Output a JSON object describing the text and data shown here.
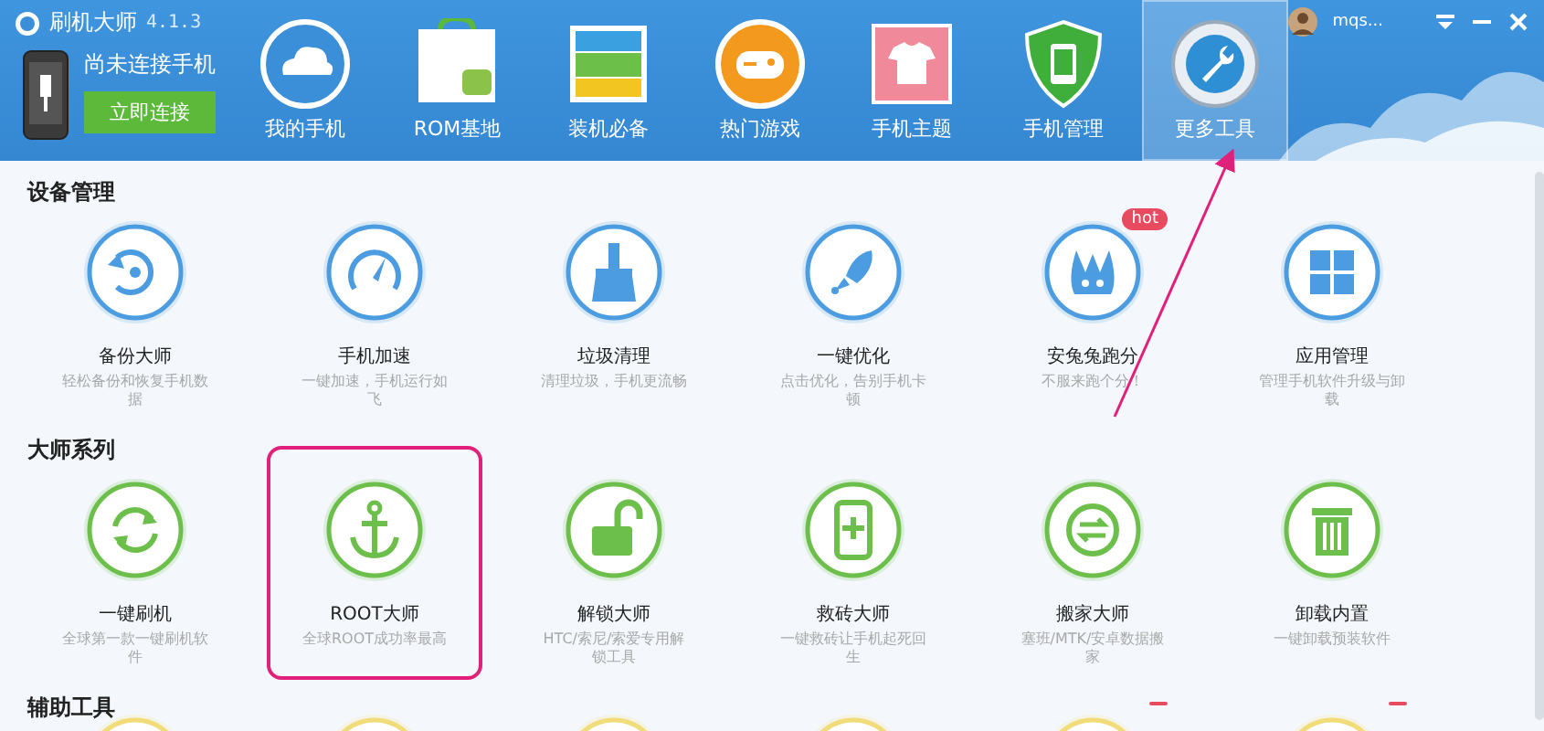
{
  "window": {
    "title": "刷机大师",
    "version": "4.1.3",
    "user": "mqs..."
  },
  "device": {
    "status": "尚未连接手机",
    "connect_button": "立即连接"
  },
  "nav": [
    {
      "label": "我的手机",
      "selected": false
    },
    {
      "label": "ROM基地",
      "selected": false
    },
    {
      "label": "装机必备",
      "selected": false
    },
    {
      "label": "热门游戏",
      "selected": false
    },
    {
      "label": "手机主题",
      "selected": false
    },
    {
      "label": "手机管理",
      "selected": false
    },
    {
      "label": "更多工具",
      "selected": true
    }
  ],
  "sections": [
    {
      "title": "设备管理",
      "kind": "blue",
      "items": [
        {
          "name": "备份大师",
          "desc": "轻松备份和恢复手机数据",
          "hot": false,
          "highlighted": false
        },
        {
          "name": "手机加速",
          "desc": "一键加速，手机运行如飞",
          "hot": false,
          "highlighted": false
        },
        {
          "name": "垃圾清理",
          "desc": "清理垃圾，手机更流畅",
          "hot": false,
          "highlighted": false
        },
        {
          "name": "一键优化",
          "desc": "点击优化，告别手机卡顿",
          "hot": false,
          "highlighted": false
        },
        {
          "name": "安兔兔跑分",
          "desc": "不服来跑个分！",
          "hot": true,
          "badge": "hot",
          "highlighted": false
        },
        {
          "name": "应用管理",
          "desc": "管理手机软件升级与卸载",
          "hot": false,
          "highlighted": false
        }
      ]
    },
    {
      "title": "大师系列",
      "kind": "green",
      "items": [
        {
          "name": "一键刷机",
          "desc": "全球第一款一键刷机软件",
          "hot": false,
          "highlighted": false
        },
        {
          "name": "ROOT大师",
          "desc": "全球ROOT成功率最高",
          "hot": false,
          "highlighted": true
        },
        {
          "name": "解锁大师",
          "desc": "HTC/索尼/索爱专用解锁工具",
          "hot": false,
          "highlighted": false
        },
        {
          "name": "救砖大师",
          "desc": "一键救砖让手机起死回生",
          "hot": false,
          "highlighted": false
        },
        {
          "name": "搬家大师",
          "desc": "塞班/MTK/安卓数据搬家",
          "hot": false,
          "highlighted": false
        },
        {
          "name": "卸载内置",
          "desc": "一键卸载预装软件",
          "hot": false,
          "highlighted": false
        }
      ]
    },
    {
      "title": "辅助工具",
      "kind": "yellow",
      "items": [
        {
          "hot": false,
          "highlighted": false
        },
        {
          "hot": false,
          "highlighted": false
        },
        {
          "hot": false,
          "highlighted": false
        },
        {
          "hot": false,
          "highlighted": false
        },
        {
          "hot": true,
          "highlighted": false
        },
        {
          "hot": true,
          "highlighted": false
        }
      ]
    }
  ]
}
